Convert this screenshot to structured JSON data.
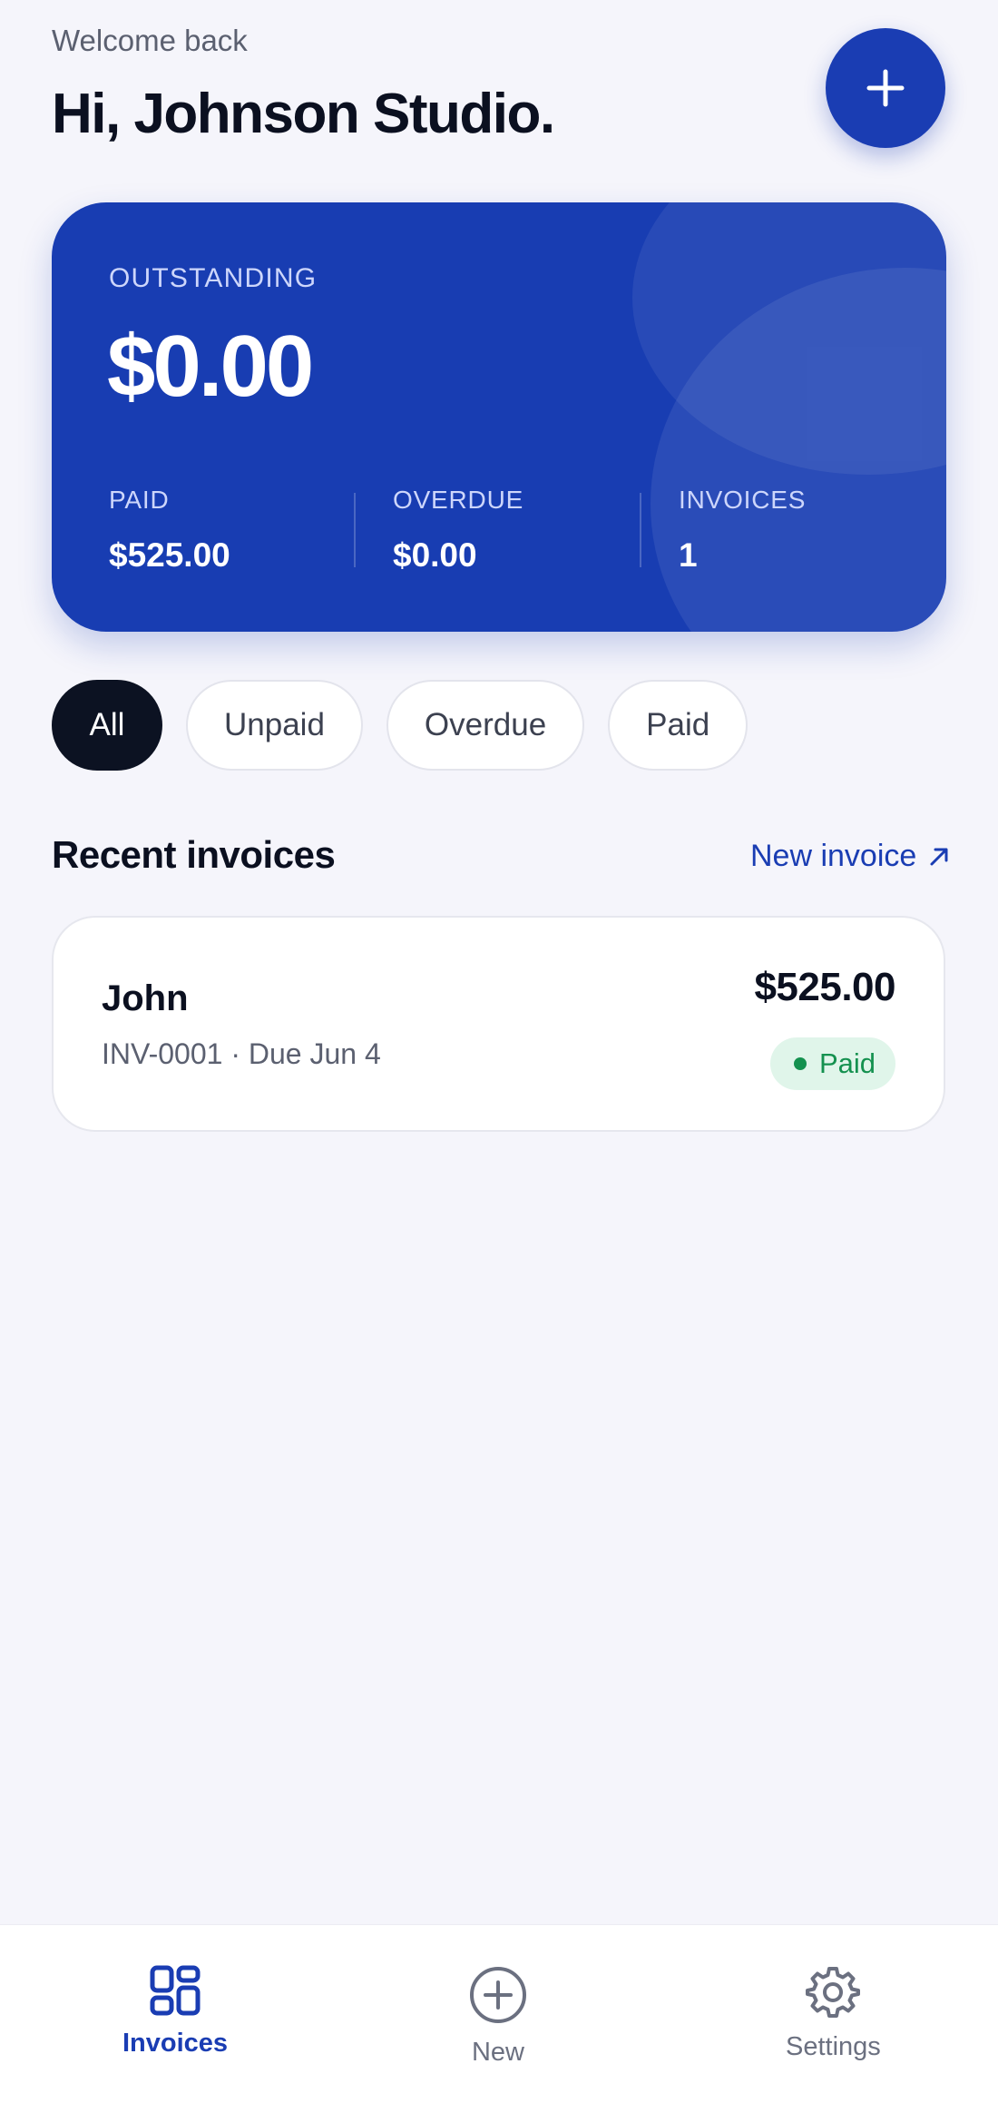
{
  "header": {
    "welcome": "Welcome back",
    "greeting": "Hi, Johnson Studio."
  },
  "fab": {
    "icon": "plus-icon"
  },
  "summary": {
    "outstanding_label": "OUTSTANDING",
    "outstanding_amount": "$0.00",
    "stats": [
      {
        "label": "PAID",
        "value": "$525.00"
      },
      {
        "label": "OVERDUE",
        "value": "$0.00"
      },
      {
        "label": "INVOICES",
        "value": "1"
      }
    ]
  },
  "filters": [
    {
      "label": "All",
      "active": true
    },
    {
      "label": "Unpaid",
      "active": false
    },
    {
      "label": "Overdue",
      "active": false
    },
    {
      "label": "Paid",
      "active": false
    }
  ],
  "recent": {
    "title": "Recent invoices",
    "new_invoice_label": "New invoice",
    "new_invoice_icon": "arrow-up-right-icon"
  },
  "invoices": [
    {
      "client": "John",
      "meta": "INV-0001 · Due Jun 4",
      "amount": "$525.00",
      "status": "Paid"
    }
  ],
  "nav": [
    {
      "label": "Invoices",
      "icon": "grid-icon",
      "active": true
    },
    {
      "label": "New",
      "icon": "plus-circle-icon",
      "active": false
    },
    {
      "label": "Settings",
      "icon": "gear-icon",
      "active": false
    }
  ],
  "colors": {
    "accent": "#1a3db3",
    "card": "#183db2",
    "background": "#f5f5fb",
    "paid_text": "#14914f",
    "paid_bg": "#e0f5ea",
    "chip_active": "#0c1222"
  }
}
